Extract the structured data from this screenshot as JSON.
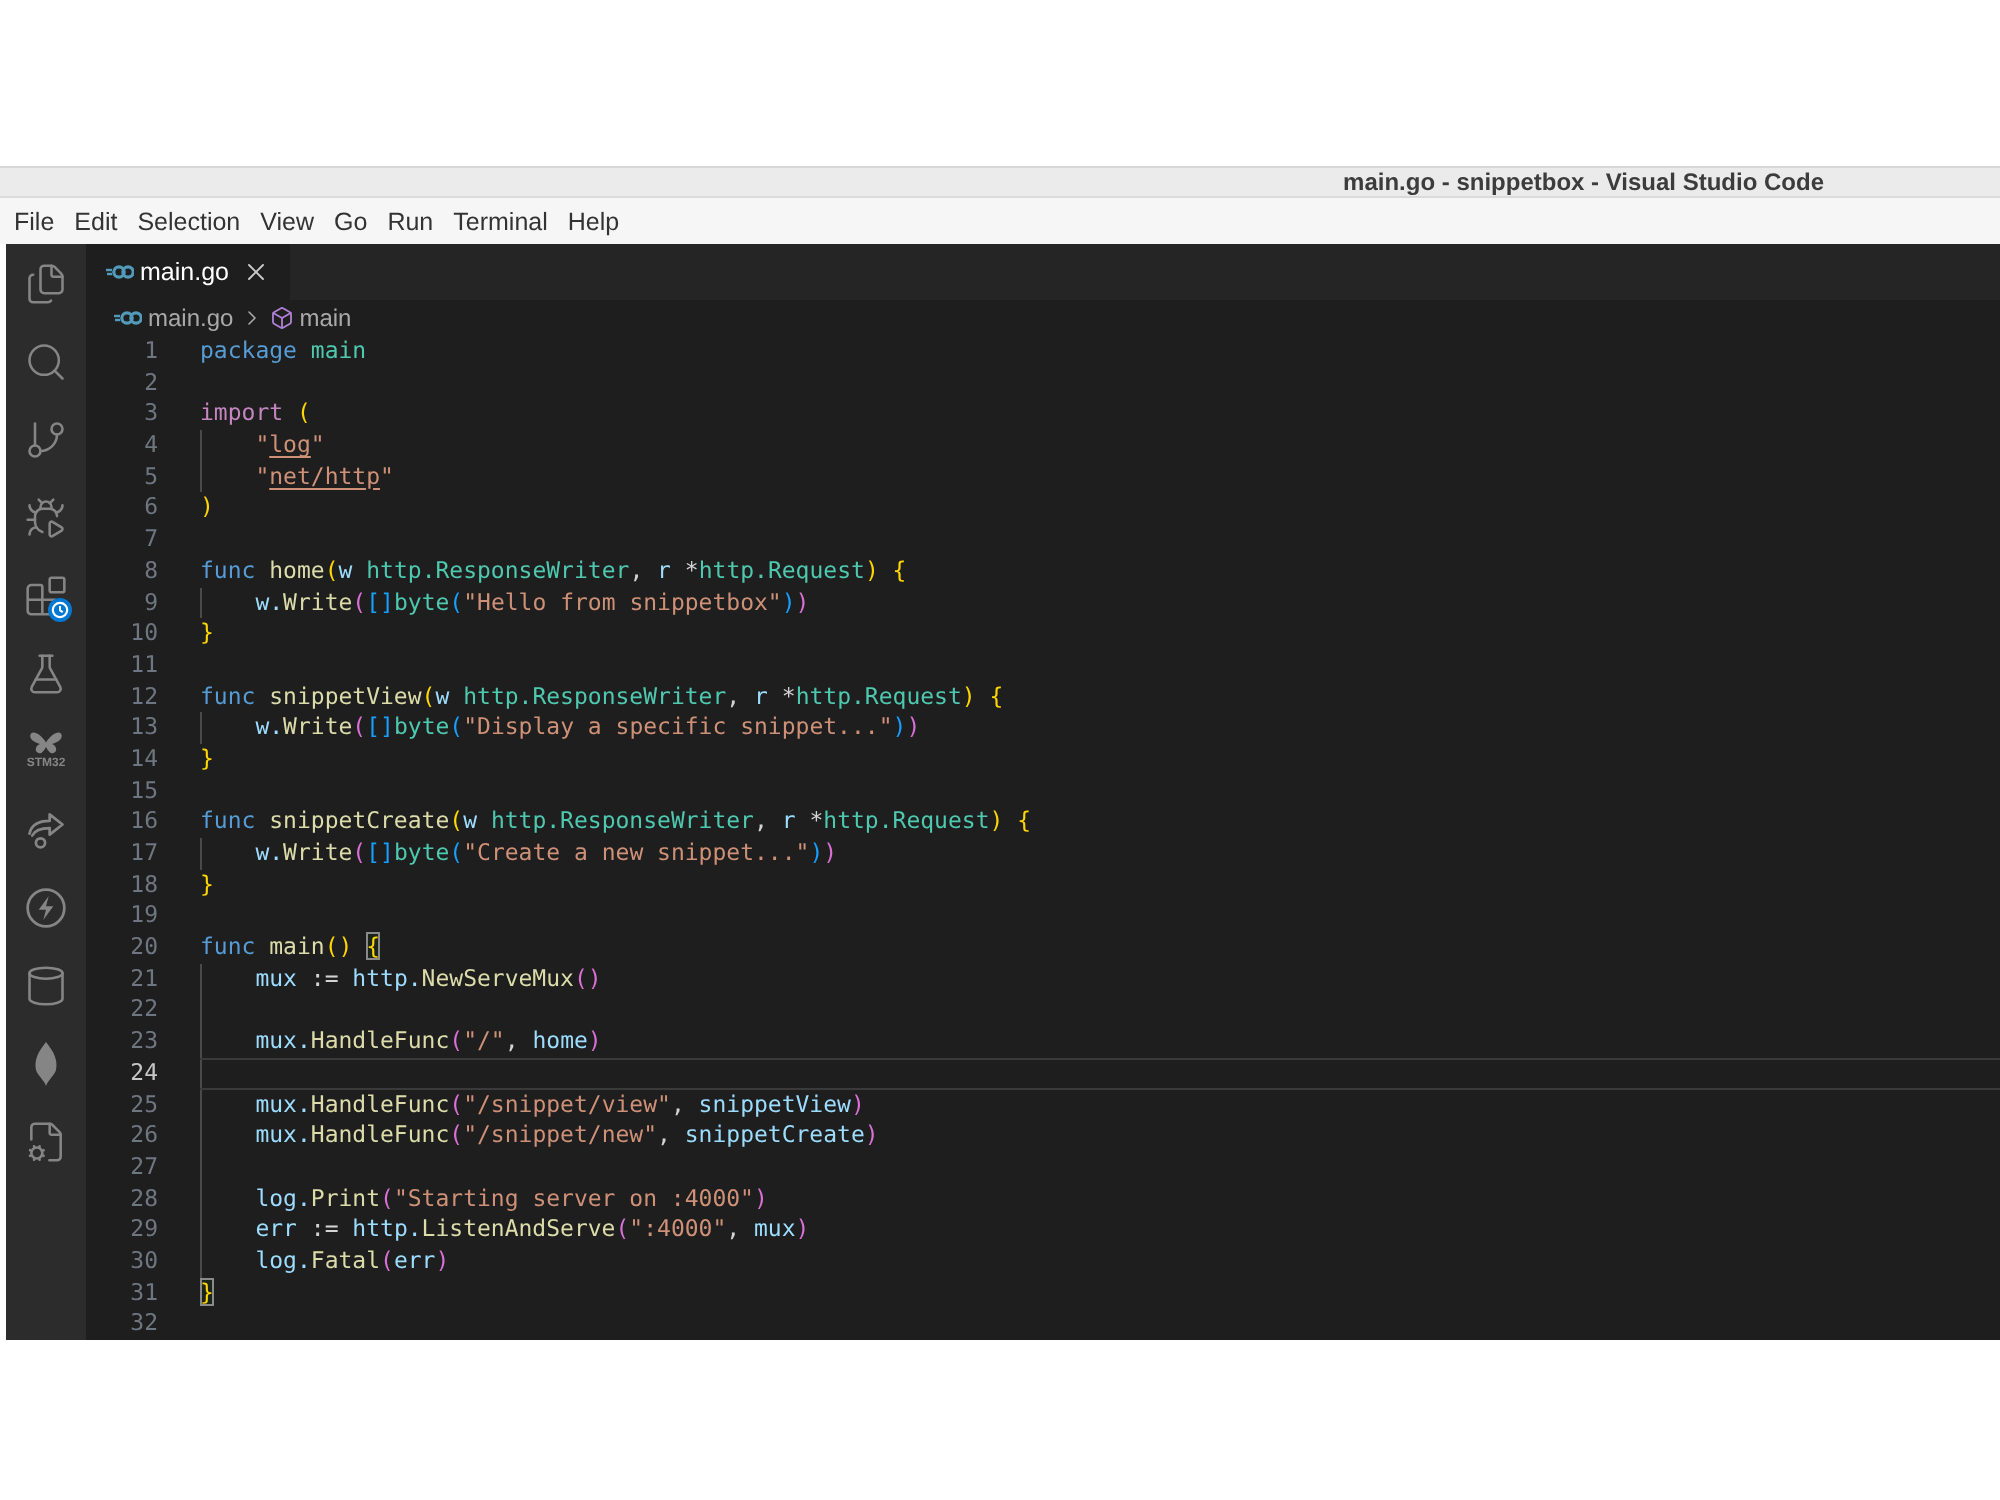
{
  "window": {
    "title": "main.go - snippetbox - Visual Studio Code"
  },
  "menu": [
    "File",
    "Edit",
    "Selection",
    "View",
    "Go",
    "Run",
    "Terminal",
    "Help"
  ],
  "activity_bar": {
    "icon_caption": "STM32"
  },
  "tabs": [
    {
      "label": "main.go",
      "selected": true
    }
  ],
  "breadcrumb": [
    {
      "label": "main.go",
      "kind": "file"
    },
    {
      "label": "main",
      "kind": "symbol"
    }
  ],
  "lines": [
    {
      "number": "1",
      "current": false,
      "indented": false,
      "tokens": [
        {
          "text": "package ",
          "kind": "keyword"
        },
        {
          "text": "main",
          "kind": "namespace"
        }
      ]
    },
    {
      "number": "2",
      "current": false,
      "indented": false
    },
    {
      "number": "3",
      "current": false,
      "indented": false,
      "tokens": [
        {
          "text": "import ",
          "kind": "control"
        },
        {
          "text": "(",
          "kind": "bracket1"
        }
      ]
    },
    {
      "number": "4",
      "current": false,
      "indented": true,
      "tokens": [
        {
          "text": "\"",
          "kind": "string"
        },
        {
          "text": "log",
          "kind": "link"
        },
        {
          "text": "\"",
          "kind": "string"
        }
      ]
    },
    {
      "number": "5",
      "current": false,
      "indented": true,
      "tokens": [
        {
          "text": "\"",
          "kind": "string"
        },
        {
          "text": "net/http",
          "kind": "link"
        },
        {
          "text": "\"",
          "kind": "string"
        }
      ]
    },
    {
      "number": "6",
      "current": false,
      "indented": false,
      "tokens": [
        {
          "text": ")",
          "kind": "bracket1"
        }
      ]
    },
    {
      "number": "7",
      "current": false,
      "indented": false
    },
    {
      "number": "8",
      "current": false,
      "indented": false,
      "tokens": [
        {
          "text": "func ",
          "kind": "keyword"
        },
        {
          "text": "home",
          "kind": "func"
        },
        {
          "text": "(",
          "kind": "bracket1"
        },
        {
          "text": "w ",
          "kind": "var"
        },
        {
          "text": "http.ResponseWriter",
          "kind": "type"
        },
        {
          "text": ", ",
          "kind": "plain"
        },
        {
          "text": "r ",
          "kind": "var"
        },
        {
          "text": "*",
          "kind": "plain"
        },
        {
          "text": "http.Request",
          "kind": "type"
        },
        {
          "text": ") {",
          "kind": "bracket1"
        }
      ]
    },
    {
      "number": "9",
      "current": false,
      "indented": true,
      "tokens": [
        {
          "text": "w.",
          "kind": "var"
        },
        {
          "text": "Write",
          "kind": "func"
        },
        {
          "text": "(",
          "kind": "bracket2"
        },
        {
          "text": "[]",
          "kind": "bracket3"
        },
        {
          "text": "byte",
          "kind": "type"
        },
        {
          "text": "(",
          "kind": "bracket3"
        },
        {
          "text": "\"Hello from snippetbox\"",
          "kind": "string"
        },
        {
          "text": ")",
          "kind": "bracket3"
        },
        {
          "text": ")",
          "kind": "bracket2"
        }
      ]
    },
    {
      "number": "10",
      "current": false,
      "indented": false,
      "tokens": [
        {
          "text": "}",
          "kind": "bracket1"
        }
      ]
    },
    {
      "number": "11",
      "current": false,
      "indented": false
    },
    {
      "number": "12",
      "current": false,
      "indented": false,
      "tokens": [
        {
          "text": "func ",
          "kind": "keyword"
        },
        {
          "text": "snippetView",
          "kind": "func"
        },
        {
          "text": "(",
          "kind": "bracket1"
        },
        {
          "text": "w ",
          "kind": "var"
        },
        {
          "text": "http.ResponseWriter",
          "kind": "type"
        },
        {
          "text": ", ",
          "kind": "plain"
        },
        {
          "text": "r ",
          "kind": "var"
        },
        {
          "text": "*",
          "kind": "plain"
        },
        {
          "text": "http.Request",
          "kind": "type"
        },
        {
          "text": ") {",
          "kind": "bracket1"
        }
      ]
    },
    {
      "number": "13",
      "current": false,
      "indented": true,
      "tokens": [
        {
          "text": "w.",
          "kind": "var"
        },
        {
          "text": "Write",
          "kind": "func"
        },
        {
          "text": "(",
          "kind": "bracket2"
        },
        {
          "text": "[]",
          "kind": "bracket3"
        },
        {
          "text": "byte",
          "kind": "type"
        },
        {
          "text": "(",
          "kind": "bracket3"
        },
        {
          "text": "\"Display a specific snippet...\"",
          "kind": "string"
        },
        {
          "text": ")",
          "kind": "bracket3"
        },
        {
          "text": ")",
          "kind": "bracket2"
        }
      ]
    },
    {
      "number": "14",
      "current": false,
      "indented": false,
      "tokens": [
        {
          "text": "}",
          "kind": "bracket1"
        }
      ]
    },
    {
      "number": "15",
      "current": false,
      "indented": false
    },
    {
      "number": "16",
      "current": false,
      "indented": false,
      "tokens": [
        {
          "text": "func ",
          "kind": "keyword"
        },
        {
          "text": "snippetCreate",
          "kind": "func"
        },
        {
          "text": "(",
          "kind": "bracket1"
        },
        {
          "text": "w ",
          "kind": "var"
        },
        {
          "text": "http.ResponseWriter",
          "kind": "type"
        },
        {
          "text": ", ",
          "kind": "plain"
        },
        {
          "text": "r ",
          "kind": "var"
        },
        {
          "text": "*",
          "kind": "plain"
        },
        {
          "text": "http.Request",
          "kind": "type"
        },
        {
          "text": ") {",
          "kind": "bracket1"
        }
      ]
    },
    {
      "number": "17",
      "current": false,
      "indented": true,
      "tokens": [
        {
          "text": "w.",
          "kind": "var"
        },
        {
          "text": "Write",
          "kind": "func"
        },
        {
          "text": "(",
          "kind": "bracket2"
        },
        {
          "text": "[]",
          "kind": "bracket3"
        },
        {
          "text": "byte",
          "kind": "type"
        },
        {
          "text": "(",
          "kind": "bracket3"
        },
        {
          "text": "\"Create a new snippet...\"",
          "kind": "string"
        },
        {
          "text": ")",
          "kind": "bracket3"
        },
        {
          "text": ")",
          "kind": "bracket2"
        }
      ]
    },
    {
      "number": "18",
      "current": false,
      "indented": false,
      "tokens": [
        {
          "text": "}",
          "kind": "bracket1"
        }
      ]
    },
    {
      "number": "19",
      "current": false,
      "indented": false
    },
    {
      "number": "20",
      "current": false,
      "indented": false,
      "tokens": [
        {
          "text": "func ",
          "kind": "keyword"
        },
        {
          "text": "main",
          "kind": "func"
        },
        {
          "text": "() ",
          "kind": "bracket1"
        },
        {
          "text": "{",
          "kind": "match"
        }
      ]
    },
    {
      "number": "21",
      "current": false,
      "indented": true,
      "tokens": [
        {
          "text": "mux ",
          "kind": "var"
        },
        {
          "text": ":= ",
          "kind": "plain"
        },
        {
          "text": "http.",
          "kind": "var"
        },
        {
          "text": "NewServeMux",
          "kind": "func"
        },
        {
          "text": "()",
          "kind": "bracket2"
        }
      ]
    },
    {
      "number": "22",
      "current": false,
      "indented": true
    },
    {
      "number": "23",
      "current": false,
      "indented": true,
      "tokens": [
        {
          "text": "mux.",
          "kind": "var"
        },
        {
          "text": "HandleFunc",
          "kind": "func"
        },
        {
          "text": "(",
          "kind": "bracket2"
        },
        {
          "text": "\"/\"",
          "kind": "string"
        },
        {
          "text": ", ",
          "kind": "plain"
        },
        {
          "text": "home",
          "kind": "var"
        },
        {
          "text": ")",
          "kind": "bracket2"
        }
      ]
    },
    {
      "number": "24",
      "current": true,
      "indented": true
    },
    {
      "number": "25",
      "current": false,
      "indented": true,
      "tokens": [
        {
          "text": "mux.",
          "kind": "var"
        },
        {
          "text": "HandleFunc",
          "kind": "func"
        },
        {
          "text": "(",
          "kind": "bracket2"
        },
        {
          "text": "\"/snippet/view\"",
          "kind": "string"
        },
        {
          "text": ", ",
          "kind": "plain"
        },
        {
          "text": "snippetView",
          "kind": "var"
        },
        {
          "text": ")",
          "kind": "bracket2"
        }
      ]
    },
    {
      "number": "26",
      "current": false,
      "indented": true,
      "tokens": [
        {
          "text": "mux.",
          "kind": "var"
        },
        {
          "text": "HandleFunc",
          "kind": "func"
        },
        {
          "text": "(",
          "kind": "bracket2"
        },
        {
          "text": "\"/snippet/new\"",
          "kind": "string"
        },
        {
          "text": ", ",
          "kind": "plain"
        },
        {
          "text": "snippetCreate",
          "kind": "var"
        },
        {
          "text": ")",
          "kind": "bracket2"
        }
      ]
    },
    {
      "number": "27",
      "current": false,
      "indented": true
    },
    {
      "number": "28",
      "current": false,
      "indented": true,
      "tokens": [
        {
          "text": "log.",
          "kind": "var"
        },
        {
          "text": "Print",
          "kind": "func"
        },
        {
          "text": "(",
          "kind": "bracket2"
        },
        {
          "text": "\"Starting server on :4000\"",
          "kind": "string"
        },
        {
          "text": ")",
          "kind": "bracket2"
        }
      ]
    },
    {
      "number": "29",
      "current": false,
      "indented": true,
      "tokens": [
        {
          "text": "err ",
          "kind": "var"
        },
        {
          "text": ":= ",
          "kind": "plain"
        },
        {
          "text": "http.",
          "kind": "var"
        },
        {
          "text": "ListenAndServe",
          "kind": "func"
        },
        {
          "text": "(",
          "kind": "bracket2"
        },
        {
          "text": "\":4000\"",
          "kind": "string"
        },
        {
          "text": ", ",
          "kind": "plain"
        },
        {
          "text": "mux",
          "kind": "var"
        },
        {
          "text": ")",
          "kind": "bracket2"
        }
      ]
    },
    {
      "number": "30",
      "current": false,
      "indented": true,
      "tokens": [
        {
          "text": "log.",
          "kind": "var"
        },
        {
          "text": "Fatal",
          "kind": "func"
        },
        {
          "text": "(",
          "kind": "bracket2"
        },
        {
          "text": "err",
          "kind": "var"
        },
        {
          "text": ")",
          "kind": "bracket2"
        }
      ]
    },
    {
      "number": "31",
      "current": false,
      "indented": false,
      "tokens": [
        {
          "text": "}",
          "kind": "match"
        }
      ]
    },
    {
      "number": "32",
      "current": false,
      "indented": false
    }
  ]
}
